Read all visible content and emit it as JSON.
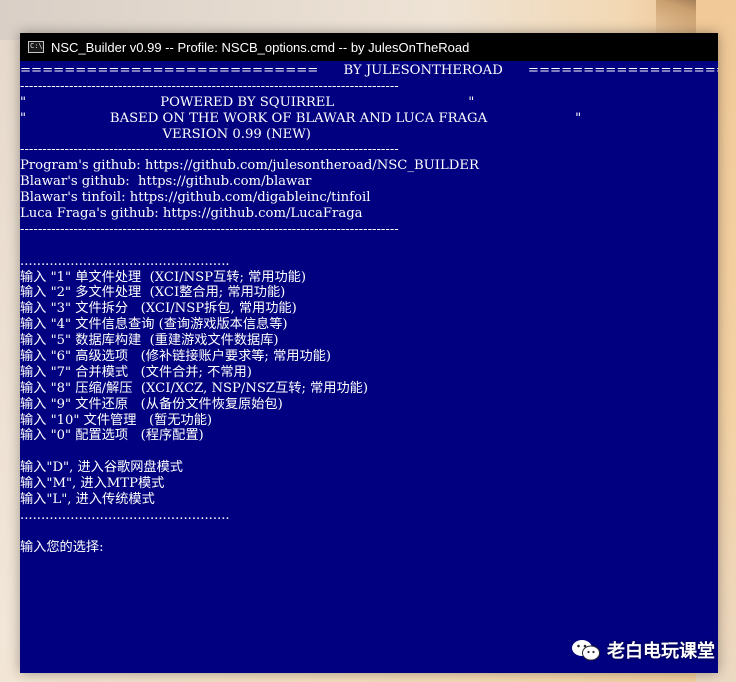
{
  "window": {
    "title": "NSC_Builder v0.99 -- Profile: NSCB_options.cmd -- by JulesOnTheRoad",
    "icon": "cmd-icon"
  },
  "console": {
    "lines": [
      "===========================      BY JULESONTHEROAD      ===========================",
      "-------------------------------------------------------------------------------------",
      "\"                                POWERED BY SQUIRREL                                \"",
      "\"                    BASED ON THE WORK OF BLAWAR AND LUCA FRAGA                     \"",
      "                                  VERSION 0.99 (NEW)",
      "-------------------------------------------------------------------------------------",
      "Program's github: https://github.com/julesontheroad/NSC_BUILDER",
      "Blawar's github:  https://github.com/blawar",
      "Blawar's tinfoil: https://github.com/digableinc/tinfoil",
      "Luca Fraga's github: https://github.com/LucaFraga",
      "-------------------------------------------------------------------------------------",
      "",
      "..................................................",
      "输入 \"1\" 单文件处理  (XCI/NSP互转; 常用功能)",
      "输入 \"2\" 多文件处理  (XCI整合用; 常用功能)",
      "输入 \"3\" 文件拆分   (XCI/NSP拆包, 常用功能)",
      "输入 \"4\" 文件信息查询 (查询游戏版本信息等)",
      "输入 \"5\" 数据库构建  (重建游戏文件数据库)",
      "输入 \"6\" 高级选项   (修补链接账户要求等; 常用功能)",
      "输入 \"7\" 合并模式   (文件合并; 不常用)",
      "输入 \"8\" 压缩/解压  (XCI/XCZ, NSP/NSZ互转; 常用功能)",
      "输入 \"9\" 文件还原   (从备份文件恢复原始包)",
      "输入 \"10\" 文件管理   (暂无功能)",
      "输入 \"0\" 配置选项   (程序配置)",
      "",
      "输入\"D\", 进入谷歌网盘模式",
      "输入\"M\", 进入MTP模式",
      "输入\"L\", 进入传统模式",
      "..................................................",
      "",
      "输入您的选择:"
    ]
  },
  "watermark": {
    "text": "老白电玩课堂",
    "icon": "wechat-icon"
  }
}
